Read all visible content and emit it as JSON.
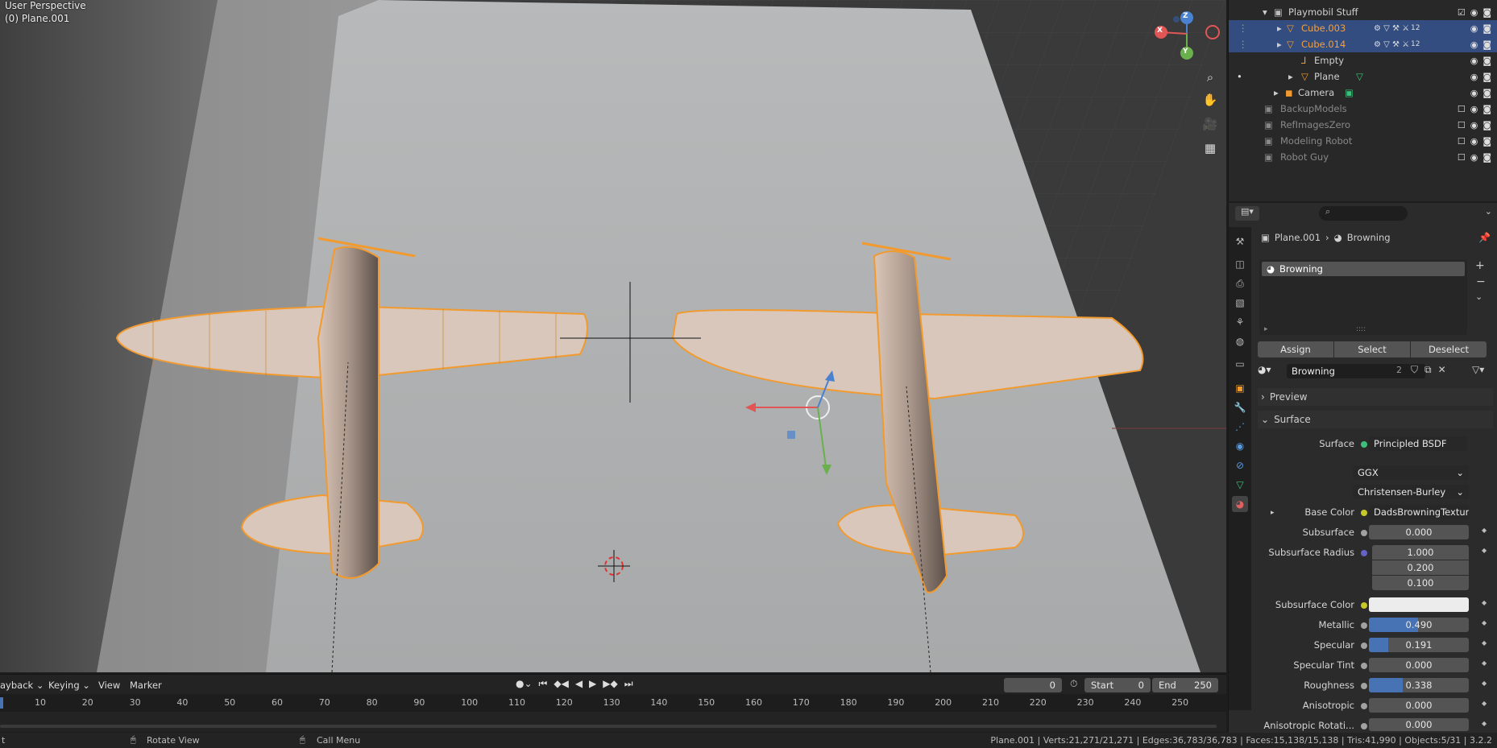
{
  "viewport": {
    "mode_label": "User Perspective",
    "object_label": "(0) Plane.001",
    "axes": {
      "x": "X",
      "y": "Y",
      "z": "Z"
    },
    "nav_icons": [
      "zoom-icon",
      "hand-pan-icon",
      "camera-icon",
      "grid-icon"
    ]
  },
  "outliner": {
    "rows": [
      {
        "label": "Playmobil Stuff"
      },
      {
        "label": "Cube.003",
        "extra": "12"
      },
      {
        "label": "Cube.014",
        "extra": "12"
      },
      {
        "label": "Empty"
      },
      {
        "label": "Plane"
      },
      {
        "label": "Camera"
      },
      {
        "label": "BackupModels"
      },
      {
        "label": "RefImagesZero"
      },
      {
        "label": "Modeling Robot"
      },
      {
        "label": "Robot Guy"
      }
    ]
  },
  "properties": {
    "search_placeholder": "",
    "breadcrumb_object": "Plane.001",
    "breadcrumb_material": "Browning",
    "slot_name": "Browning",
    "assign_label": "Assign",
    "select_label": "Select",
    "deselect_label": "Deselect",
    "material_name": "Browning",
    "material_users": "2",
    "preview_label": "Preview",
    "surface_section": "Surface",
    "surface_label": "Surface",
    "surface_value": "Principled BSDF",
    "distribution": "GGX",
    "subsurface_method": "Christensen-Burley",
    "base_color_label": "Base Color",
    "base_color_value": "DadsBrowningTextureV...",
    "subsurface_label": "Subsurface",
    "subsurface_value": "0.000",
    "subsurface_radius_label": "Subsurface Radius",
    "subsurface_radius": [
      "1.000",
      "0.200",
      "0.100"
    ],
    "subsurface_color_label": "Subsurface Color",
    "metallic_label": "Metallic",
    "metallic_value": "0.490",
    "metallic_fill": 0.49,
    "specular_label": "Specular",
    "specular_value": "0.191",
    "specular_fill": 0.191,
    "specular_tint_label": "Specular Tint",
    "specular_tint_value": "0.000",
    "roughness_label": "Roughness",
    "roughness_value": "0.338",
    "roughness_fill": 0.338,
    "anisotropic_label": "Anisotropic",
    "anisotropic_value": "0.000",
    "anisotropic_rot_label": "Anisotropic Rotati...",
    "anisotropic_rot_value": "0.000"
  },
  "timeline": {
    "menu": [
      "ayback",
      "Keying",
      "View",
      "Marker"
    ],
    "current_frame": "0",
    "start_label": "Start",
    "start_value": "0",
    "end_label": "End",
    "end_value": "250",
    "ruler": [
      "10",
      "20",
      "30",
      "40",
      "50",
      "60",
      "70",
      "80",
      "90",
      "100",
      "110",
      "120",
      "130",
      "140",
      "150",
      "160",
      "170",
      "180",
      "190",
      "200",
      "210",
      "220",
      "230",
      "240",
      "250"
    ]
  },
  "status": {
    "left_char": "t",
    "rotate_view": "Rotate View",
    "call_menu": "Call Menu",
    "stats": "Plane.001 | Verts:21,271/21,271 | Edges:36,783/36,783 | Faces:15,138/15,138 | Tris:41,990 | Objects:5/31 | 3.2.2"
  },
  "colors": {
    "accent": "#4772b3",
    "selection_orange": "#f29a2e",
    "outliner_selected": "#334d80"
  }
}
